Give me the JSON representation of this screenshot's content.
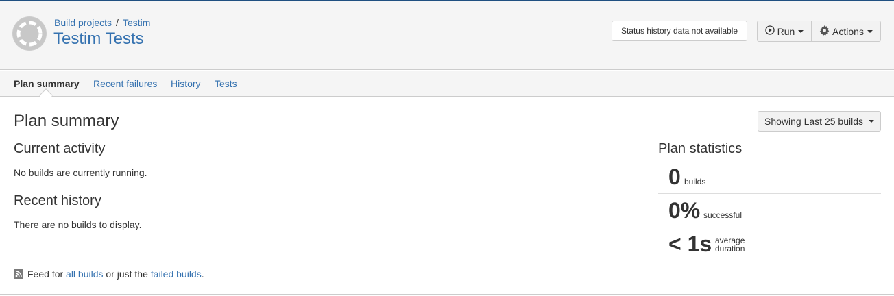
{
  "breadcrumb": {
    "project": "Build projects",
    "plan": "Testim"
  },
  "page_title": "Testim Tests",
  "header": {
    "status_history": "Status history data not available",
    "run_label": "Run",
    "actions_label": "Actions"
  },
  "tabs": [
    {
      "label": "Plan summary",
      "active": true
    },
    {
      "label": "Recent failures",
      "active": false
    },
    {
      "label": "History",
      "active": false
    },
    {
      "label": "Tests",
      "active": false
    }
  ],
  "main": {
    "title": "Plan summary",
    "showing_label": "Showing Last 25 builds",
    "current_activity_heading": "Current activity",
    "current_activity_text": "No builds are currently running.",
    "recent_history_heading": "Recent history",
    "recent_history_text": "There are no builds to display."
  },
  "statistics": {
    "heading": "Plan statistics",
    "builds_value": "0",
    "builds_label": "builds",
    "success_value": "0%",
    "success_label": "successful",
    "duration_value": "< 1s",
    "duration_label_1": "average",
    "duration_label_2": "duration"
  },
  "feed": {
    "prefix": "Feed for",
    "all_builds": "all builds",
    "middle": "or just the",
    "failed_builds": "failed builds",
    "suffix": "."
  },
  "colors": {
    "link": "#3572b0",
    "header_bg": "#f5f5f5",
    "top_border": "#205081"
  }
}
